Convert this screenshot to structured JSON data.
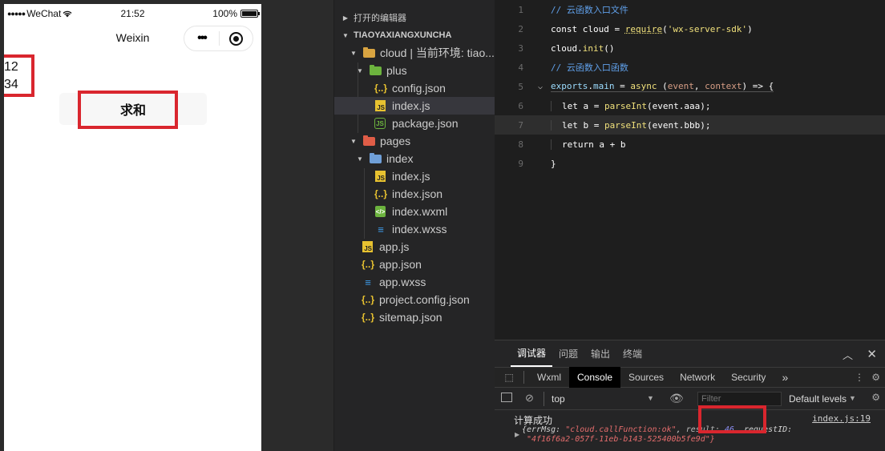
{
  "phone": {
    "carrier": "WeChat",
    "time": "21:52",
    "battery": "100%",
    "battery_level": 1.0,
    "nav_title": "Weixin",
    "capsule_more": "•••",
    "value_a": "12",
    "value_b": "34",
    "sum_button": "求和"
  },
  "explorer": {
    "open_editors": "打开的编辑器",
    "project": "TIAOYAXIANGXUNCHA",
    "tree": [
      {
        "label": "cloud | 当前环境: tiao...",
        "icon": "folder-cloud-icon"
      },
      {
        "label": "plus",
        "icon": "folder-plus-icon"
      },
      {
        "label": "config.json",
        "icon": "json-icon"
      },
      {
        "label": "index.js",
        "icon": "js-icon"
      },
      {
        "label": "package.json",
        "icon": "node-icon"
      },
      {
        "label": "pages",
        "icon": "folder-pages-icon"
      },
      {
        "label": "index",
        "icon": "folder-index-icon"
      },
      {
        "label": "index.js",
        "icon": "js-icon"
      },
      {
        "label": "index.json",
        "icon": "json-icon"
      },
      {
        "label": "index.wxml",
        "icon": "wxml-icon"
      },
      {
        "label": "index.wxss",
        "icon": "wxss-icon"
      },
      {
        "label": "app.js",
        "icon": "js-icon"
      },
      {
        "label": "app.json",
        "icon": "json-icon"
      },
      {
        "label": "app.wxss",
        "icon": "wxss-icon"
      },
      {
        "label": "project.config.json",
        "icon": "json-icon"
      },
      {
        "label": "sitemap.json",
        "icon": "json-icon"
      }
    ]
  },
  "editor": {
    "line_numbers": [
      "1",
      "2",
      "3",
      "4",
      "5",
      "6",
      "7",
      "8",
      "9"
    ],
    "l1": "// 云函数入口文件",
    "l2_kw": "const",
    "l2_var": " cloud = ",
    "l2_fn": "require",
    "l2_open": "(",
    "l2_str": "'wx-server-sdk'",
    "l2_close": ")",
    "l3_obj": "cloud.",
    "l3_fn": "init",
    "l3_rest": "()",
    "l4": "// 云函数入口函数",
    "l5_exports": "exports",
    "l5_dot": ".",
    "l5_main": "main",
    "l5_eq": " = ",
    "l5_async": "async",
    "l5_paren": " (",
    "l5_event": "event",
    "l5_comma": ", ",
    "l5_context": "context",
    "l5_arrow": ") => {",
    "l6_let": "let",
    "l6_a": " a = ",
    "l6_fn": "parseInt",
    "l6_arg": "(event.aaa);",
    "l7_let": "let",
    "l7_b": " b = ",
    "l7_fn": "parseInt",
    "l7_arg": "(event.bbb);",
    "l8_ret": "return",
    "l8_expr": " a + b",
    "l9": "}"
  },
  "devtools": {
    "tabs": [
      "调试器",
      "问题",
      "输出",
      "终端"
    ],
    "subtabs": [
      "Wxml",
      "Console",
      "Sources",
      "Network",
      "Security"
    ],
    "more_tabs": "»",
    "context": "top",
    "filter_placeholder": "Filter",
    "levels": "Default levels",
    "log_message": "计算成功",
    "log_source": "index.js:19",
    "obj_open": "{errMsg: ",
    "obj_errmsg": "\"cloud.callFunction:ok\"",
    "obj_mid": ", ",
    "obj_result_key": "result: ",
    "obj_result_val": "46",
    "obj_req_key": ", requestID:",
    "obj_req_val": "\"4f16f6a2-057f-11eb-b143-525400b5fe9d\"}"
  }
}
